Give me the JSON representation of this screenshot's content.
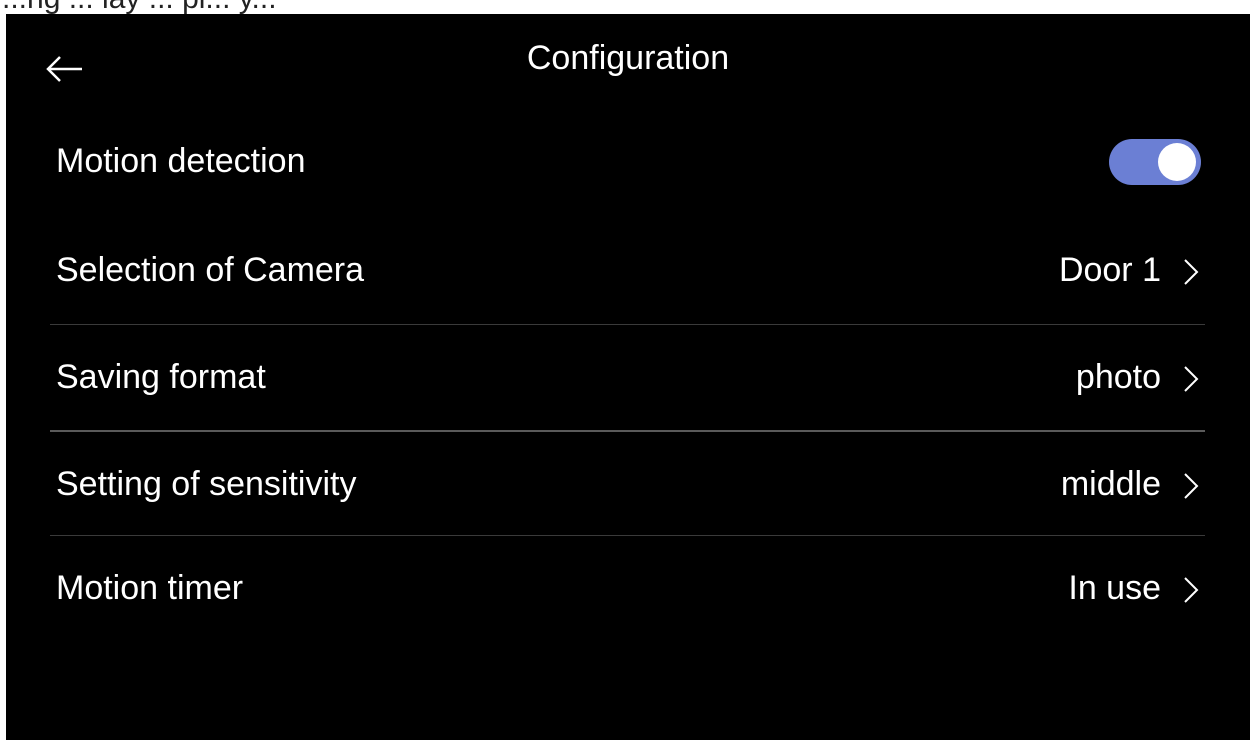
{
  "top_strip": {
    "text": "...ng ... lay ... pl... y..."
  },
  "header": {
    "title": "Configuration",
    "back_icon": "arrow-left-icon"
  },
  "settings": {
    "motion_detection": {
      "label": "Motion detection",
      "enabled": true
    },
    "camera": {
      "label": "Selection of Camera",
      "value": "Door 1"
    },
    "saving_format": {
      "label": "Saving format",
      "value": "photo"
    },
    "sensitivity": {
      "label": "Setting of sensitivity",
      "value": "middle"
    },
    "motion_timer": {
      "label": "Motion timer",
      "value": "In use"
    }
  },
  "colors": {
    "background": "#000000",
    "text": "#ffffff",
    "toggle_on": "#6b7fd4",
    "divider": "#3a3a3a"
  }
}
